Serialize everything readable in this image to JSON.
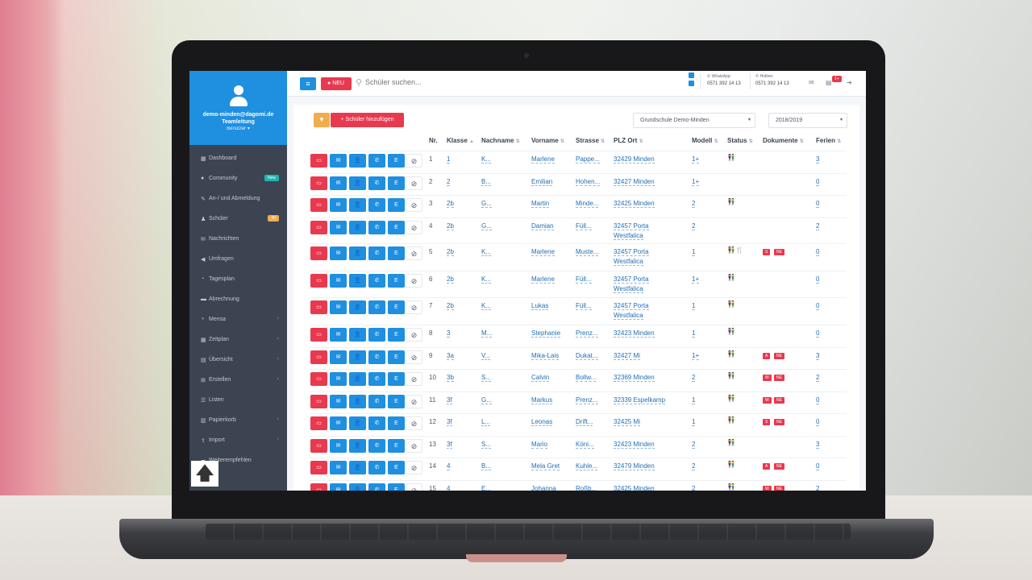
{
  "user": {
    "email": "demo-minden@dagomi.de",
    "role": "Teamleitung",
    "type": "Benutzer"
  },
  "sidebar": {
    "items": [
      {
        "label": "Dashboard",
        "icon": "dashboard-icon",
        "badge": "",
        "chevron": false
      },
      {
        "label": "Community",
        "icon": "comment-icon",
        "badge": "New",
        "chevron": false
      },
      {
        "label": "An-/ und Abmeldung",
        "icon": "edit-icon",
        "badge": "",
        "chevron": false
      },
      {
        "label": "Schüler",
        "icon": "user-icon",
        "badge": "26",
        "chevron": false
      },
      {
        "label": "Nachrichten",
        "icon": "envelope-icon",
        "badge": "",
        "chevron": false
      },
      {
        "label": "Umfragen",
        "icon": "bullhorn-icon",
        "badge": "",
        "chevron": false
      },
      {
        "label": "Tagesplan",
        "icon": "clock-icon",
        "badge": "",
        "chevron": false
      },
      {
        "label": "Abrechnung",
        "icon": "money-icon",
        "badge": "",
        "chevron": false
      },
      {
        "label": "Mensa",
        "icon": "cutlery-icon",
        "badge": "",
        "chevron": true
      },
      {
        "label": "Zeitplan",
        "icon": "calendar-icon",
        "badge": "",
        "chevron": true
      },
      {
        "label": "Übersicht",
        "icon": "table-icon",
        "badge": "",
        "chevron": true
      },
      {
        "label": "Erstellen",
        "icon": "plus-square-icon",
        "badge": "",
        "chevron": true
      },
      {
        "label": "Listen",
        "icon": "list-icon",
        "badge": "",
        "chevron": false
      },
      {
        "label": "Papierkorb",
        "icon": "trash-icon",
        "badge": "",
        "chevron": true
      },
      {
        "label": "Import",
        "icon": "upload-icon",
        "badge": "",
        "chevron": true
      },
      {
        "label": "Weiterempfehlen",
        "icon": "share-icon",
        "badge": "",
        "chevron": false
      }
    ]
  },
  "topbar": {
    "neu_label": "NEU",
    "search_placeholder": "Schüler suchen...",
    "whatsapp_label": "WhatsApp:",
    "whatsapp_number": "0571 392 14 13",
    "hotline_label": "Hotline:",
    "hotline_number": "0571 392 14 13",
    "notification_count": "1+"
  },
  "toolbar": {
    "add_label": "Schüler hinzufügen",
    "school_select": "Grundschule Demo-Minden",
    "year_select": "2018/2019"
  },
  "table": {
    "headers": [
      "Nr.",
      "Klasse",
      "Nachname",
      "Vorname",
      "Strasse",
      "PLZ Ort",
      "Modell",
      "Status",
      "Dokumente",
      "Ferien"
    ],
    "rows": [
      {
        "nr": "1",
        "klasse": "1",
        "nachname": "K...",
        "vorname": "Marlene",
        "strasse": "Pappe...",
        "plz1": "32429 Minden",
        "plz2": "",
        "modell": "1+",
        "status": "👫",
        "docs": [],
        "ferien": "3"
      },
      {
        "nr": "2",
        "klasse": "2",
        "nachname": "B...",
        "vorname": "Emilian",
        "strasse": "Hohen...",
        "plz1": "32427 Minden",
        "plz2": "",
        "modell": "1+",
        "status": "",
        "docs": [],
        "ferien": "0"
      },
      {
        "nr": "3",
        "klasse": "2b",
        "nachname": "G...",
        "vorname": "Martin",
        "strasse": "Minde...",
        "plz1": "32425 Minden",
        "plz2": "",
        "modell": "2",
        "status": "👫",
        "docs": [],
        "ferien": "0"
      },
      {
        "nr": "4",
        "klasse": "2b",
        "nachname": "G...",
        "vorname": "Damian",
        "strasse": "Füll...",
        "plz1": "32457 Porta",
        "plz2": "Westfalica",
        "modell": "2",
        "status": "",
        "docs": [],
        "ferien": "2"
      },
      {
        "nr": "5",
        "klasse": "2b",
        "nachname": "K...",
        "vorname": "Marlene",
        "strasse": "Muste...",
        "plz1": "32457 Porta",
        "plz2": "Westfalica",
        "modell": "1",
        "status": "👫🍴",
        "docs": [
          "S",
          "NE"
        ],
        "ferien": "0"
      },
      {
        "nr": "6",
        "klasse": "2b",
        "nachname": "K...",
        "vorname": "Marlene",
        "strasse": "Füll...",
        "plz1": "32457 Porta",
        "plz2": "Westfalica",
        "modell": "1+",
        "status": "👫",
        "docs": [],
        "ferien": "0"
      },
      {
        "nr": "7",
        "klasse": "2b",
        "nachname": "K...",
        "vorname": "Lukas",
        "strasse": "Füll...",
        "plz1": "32457 Porta",
        "plz2": "Westfalica",
        "modell": "1",
        "status": "👫",
        "docs": [],
        "ferien": "0"
      },
      {
        "nr": "8",
        "klasse": "3",
        "nachname": "M...",
        "vorname": "Stephanie",
        "strasse": "Prenz...",
        "plz1": "32423 Minden",
        "plz2": "",
        "modell": "1",
        "status": "👫",
        "docs": [],
        "ferien": "0"
      },
      {
        "nr": "9",
        "klasse": "3a",
        "nachname": "V...",
        "vorname": "Mika-Lais",
        "strasse": "Dukat...",
        "plz1": "32427 Mi",
        "plz2": "",
        "modell": "1+",
        "status": "👫",
        "docs": [
          "A",
          "NE"
        ],
        "ferien": "3"
      },
      {
        "nr": "10",
        "klasse": "3b",
        "nachname": "S...",
        "vorname": "Calvin",
        "strasse": "Bollw...",
        "plz1": "32369 Minden",
        "plz2": "",
        "modell": "2",
        "status": "👫",
        "docs": [
          "W",
          "NE"
        ],
        "ferien": "2"
      },
      {
        "nr": "11",
        "klasse": "3f",
        "nachname": "G...",
        "vorname": "Markus",
        "strasse": "Prenz...",
        "plz1": "32339 Espelkamp",
        "plz2": "",
        "modell": "1",
        "status": "👫",
        "docs": [
          "W",
          "NE"
        ],
        "ferien": "0"
      },
      {
        "nr": "12",
        "klasse": "3f",
        "nachname": "L...",
        "vorname": "Leonas",
        "strasse": "Drift...",
        "plz1": "32425 Mi",
        "plz2": "",
        "modell": "1",
        "status": "👫",
        "docs": [
          "S",
          "NE"
        ],
        "ferien": "0"
      },
      {
        "nr": "13",
        "klasse": "3f",
        "nachname": "S...",
        "vorname": "Mario",
        "strasse": "Köni...",
        "plz1": "32423 Minden",
        "plz2": "",
        "modell": "2",
        "status": "👫",
        "docs": [],
        "ferien": "3"
      },
      {
        "nr": "14",
        "klasse": "4",
        "nachname": "B...",
        "vorname": "Mela Gret",
        "strasse": "Kuhle...",
        "plz1": "32479 Minden",
        "plz2": "",
        "modell": "2",
        "status": "👫",
        "docs": [
          "A",
          "NE"
        ],
        "ferien": "0"
      },
      {
        "nr": "15",
        "klasse": "4",
        "nachname": "E...",
        "vorname": "Johanna",
        "strasse": "Roßb...",
        "plz1": "32425 Minden",
        "plz2": "",
        "modell": "2",
        "status": "👫",
        "docs": [
          "W",
          "NE"
        ],
        "ferien": "2"
      }
    ]
  },
  "row_action_labels": {
    "card": "▭",
    "mail": "✉",
    "person": "👤",
    "phone": "✆",
    "e": "E",
    "ban": "⊘"
  }
}
